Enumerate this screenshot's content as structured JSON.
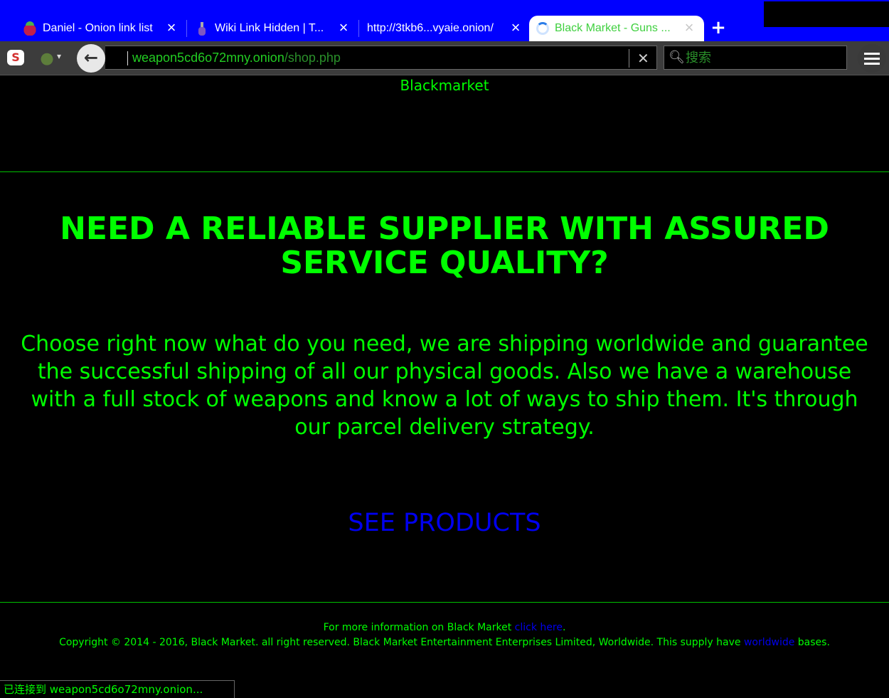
{
  "browser": {
    "tabs": [
      {
        "label": "Daniel - Onion link list",
        "icon": "raspberry-icon",
        "active": false
      },
      {
        "label": "Wiki Link Hidden | T...",
        "icon": "bottle-icon",
        "active": false
      },
      {
        "label": "http://3tkb6...vyaie.onion/",
        "icon": "",
        "active": false
      },
      {
        "label": "Black Market - Guns ...",
        "icon": "loading-spinner-icon",
        "active": true
      }
    ],
    "new_tab_label": "+",
    "close_label": "×",
    "url_host": "weapon5cd6o72mny.onion",
    "url_path": "/shop.php",
    "url_clear_label": "✕",
    "back_label": "←",
    "search_placeholder": "搜索",
    "s_icon_label": "S",
    "status_text": "已连接到 weapon5cd6o72mny.onion..."
  },
  "page": {
    "site_title": "Blackmarket",
    "headline": "NEED A RELIABLE SUPPLIER WITH ASSURED SERVICE QUALITY?",
    "intro": "Choose right now what do you need, we are shipping worldwide and guarantee the successful shipping of all our physical goods. Also we have a warehouse with a full stock of weapons and know a lot of ways to ship them. It's through our parcel delivery strategy.",
    "cta": "SEE PRODUCTS",
    "footer": {
      "info_prefix": "For more information on Black Market ",
      "info_link": "click here",
      "info_suffix": ".",
      "copyright_prefix": "Copyright © 2014 - 2016, Black Market. all right reserved. Black Market Entertainment Enterprises Limited, Worldwide. This supply have ",
      "copyright_link": "worldwide",
      "copyright_suffix": " bases."
    }
  },
  "colors": {
    "tabstrip": "#0000ff",
    "page_bg": "#000000",
    "text_green": "#00ff00",
    "link_blue": "#0000ee",
    "active_tab_text": "#3fd03f"
  }
}
